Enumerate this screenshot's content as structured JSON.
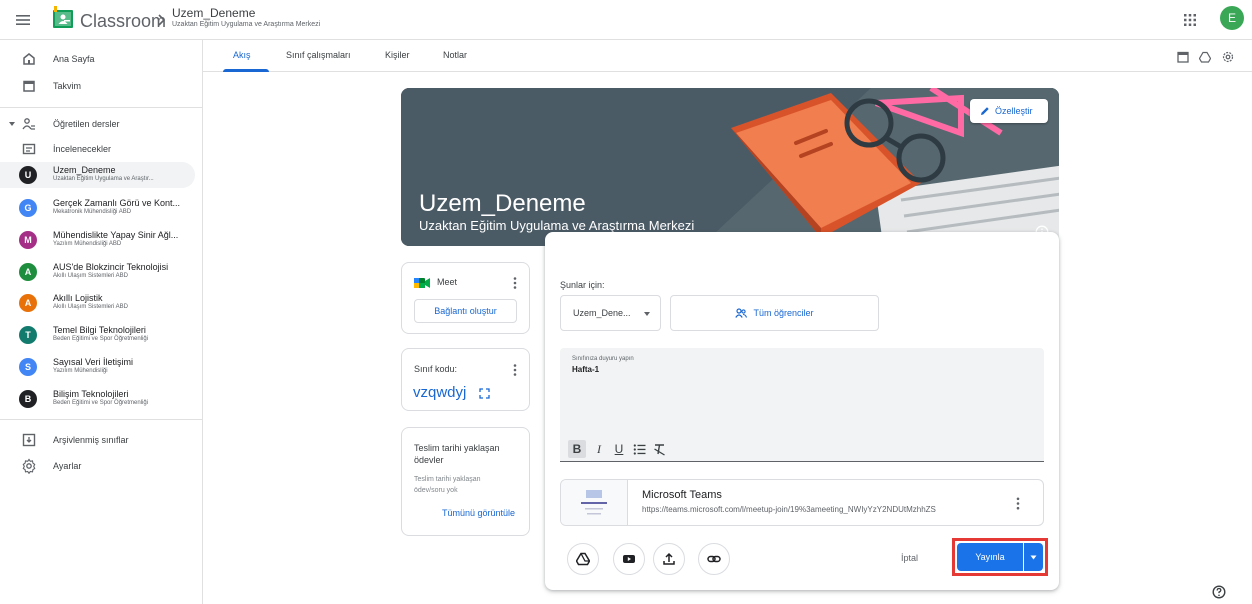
{
  "header": {
    "app_name": "Classroom",
    "course_title": "Uzem_Deneme",
    "course_subtitle": "Uzaktan Eğitim Uygulama ve Araştırma Merkezi",
    "avatar_letter": "E"
  },
  "sidebar": {
    "home": "Ana Sayfa",
    "calendar": "Takvim",
    "taught": "Öğretilen dersler",
    "to_review": "İncelenecekler",
    "courses": [
      {
        "letter": "U",
        "name": "Uzem_Deneme",
        "sub": "Uzaktan Eğitim Uygulama ve Araştır...",
        "color": "#202124"
      },
      {
        "letter": "G",
        "name": "Gerçek Zamanlı Görü ve Kont...",
        "sub": "Mekatronik Mühendisliği ABD",
        "color": "#4285f4"
      },
      {
        "letter": "M",
        "name": "Mühendislikte Yapay Sinir Ağl...",
        "sub": "Yazılım Mühendisliği ABD",
        "color": "#a52e87"
      },
      {
        "letter": "A",
        "name": "AUS'de Blokzincir Teknolojisi",
        "sub": "Akıllı Ulaşım Sistemleri ABD",
        "color": "#1e8e3e"
      },
      {
        "letter": "A",
        "name": "Akıllı Lojistik",
        "sub": "Akıllı Ulaşım Sistemleri ABD",
        "color": "#e8710a"
      },
      {
        "letter": "T",
        "name": "Temel Bilgi Teknolojileri",
        "sub": "Beden Eğitimi ve Spor Öğretmenliği",
        "color": "#137b6d"
      },
      {
        "letter": "S",
        "name": "Sayısal Veri İletişimi",
        "sub": "Yazılım Mühendisliği",
        "color": "#4285f4"
      },
      {
        "letter": "B",
        "name": "Bilişim Teknolojileri",
        "sub": "Beden Eğitimi ve Spor Öğretmenliği",
        "color": "#202124"
      }
    ],
    "archived": "Arşivlenmiş sınıflar",
    "settings": "Ayarlar"
  },
  "tabs": [
    "Akış",
    "Sınıf çalışmaları",
    "Kişiler",
    "Notlar"
  ],
  "banner": {
    "title": "Uzem_Deneme",
    "subtitle": "Uzaktan Eğitim Uygulama ve Araştırma Merkezi",
    "customize": "Özelleştir"
  },
  "meet": {
    "label": "Meet",
    "button": "Bağlantı oluştur"
  },
  "class_code": {
    "label": "Sınıf kodu:",
    "value": "vzqwdyj"
  },
  "upcoming": {
    "title": "Teslim tarihi yaklaşan ödevler",
    "empty": "Teslim tarihi yaklaşan ödev/soru yok",
    "view_all": "Tümünü görüntüle"
  },
  "composer": {
    "for_label": "Şunlar için:",
    "class_value": "Uzem_Dene...",
    "students": "Tüm öğrenciler",
    "placeholder": "Sınıfınıza duyuru yapın",
    "text": "Hafta-1",
    "bold": "B",
    "italic": "I",
    "underline": "U",
    "attachment_title": "Microsoft Teams",
    "attachment_url": "https://teams.microsoft.com/l/meetup-join/19%3ameeting_NWIyYzY2NDUtMzhhZS",
    "cancel": "İptal",
    "publish": "Yayınla"
  },
  "colors": {
    "accent": "#1967d2",
    "publish": "#1a73e8",
    "highlight": "#e53935"
  }
}
